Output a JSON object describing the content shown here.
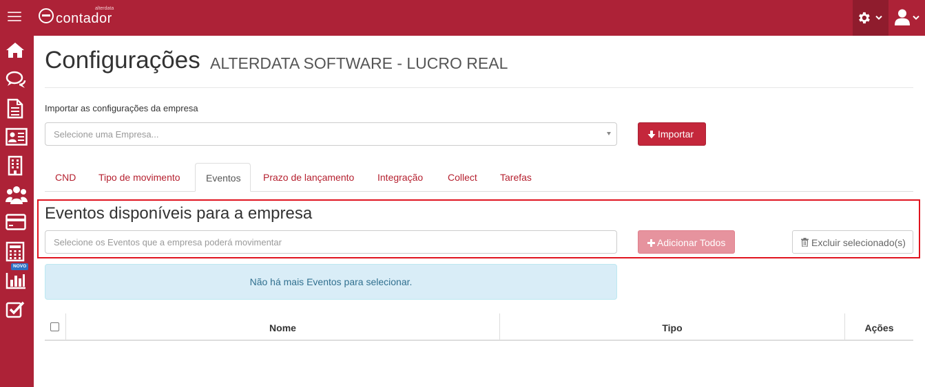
{
  "brand": {
    "logo_text": "contador",
    "logo_small": "alterdata"
  },
  "colors": {
    "brand": "#ad2237",
    "brand_dark": "#8f1c2d",
    "primary_button": "#c4273b",
    "disabled_button": "#e6939e",
    "info_bg": "#d9edf7",
    "info_text": "#31708f",
    "highlight_border": "#e0131e",
    "badge": "#2f72c4"
  },
  "topbar": {
    "menu_icon": "hamburger-icon",
    "settings_icon": "gear-icon",
    "user_icon": "user-icon"
  },
  "sidebar": {
    "items": [
      {
        "icon": "home-icon"
      },
      {
        "icon": "chat-icon"
      },
      {
        "icon": "document-icon"
      },
      {
        "icon": "id-card-icon"
      },
      {
        "icon": "building-icon"
      },
      {
        "icon": "users-icon"
      },
      {
        "icon": "credit-card-icon"
      },
      {
        "icon": "calculator-icon"
      },
      {
        "icon": "bar-chart-icon",
        "badge": "NOVO"
      },
      {
        "icon": "checkbox-icon"
      }
    ]
  },
  "page": {
    "title": "Configurações",
    "subtitle": "ALTERDATA SOFTWARE - LUCRO REAL"
  },
  "import": {
    "label": "Importar as configurações da empresa",
    "select_placeholder": "Selecione uma Empresa...",
    "button_label": "Importar"
  },
  "tabs": [
    {
      "label": "CND",
      "active": false
    },
    {
      "label": "Tipo de movimento",
      "active": false
    },
    {
      "label": "Eventos",
      "active": true
    },
    {
      "label": "Prazo de lançamento",
      "active": false
    },
    {
      "label": "Integração",
      "active": false
    },
    {
      "label": "Collect",
      "active": false
    },
    {
      "label": "Tarefas",
      "active": false
    }
  ],
  "events": {
    "section_title": "Eventos disponíveis para a empresa",
    "input_placeholder": "Selecione os Eventos que a empresa poderá movimentar",
    "add_all_label": "Adicionar Todos",
    "delete_selected_label": "Excluir selecionado(s)",
    "empty_message": "Não há mais Eventos para selecionar."
  },
  "table": {
    "columns": [
      "Nome",
      "Tipo",
      "Ações"
    ]
  }
}
